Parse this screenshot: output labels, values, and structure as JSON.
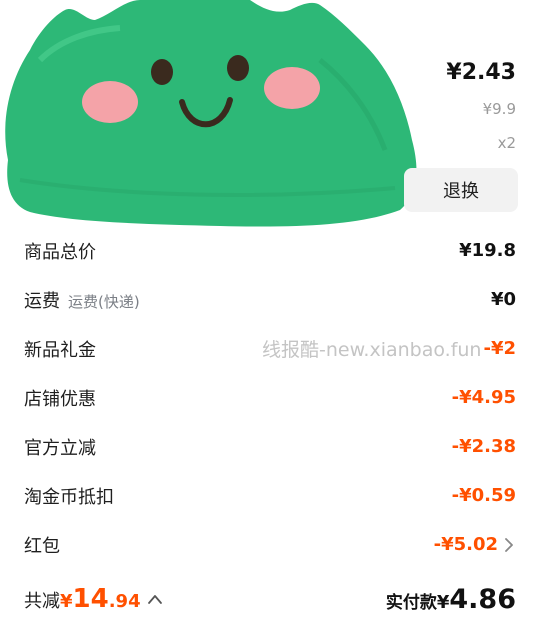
{
  "item": {
    "price": "¥2.43",
    "original_price": "¥9.9",
    "quantity": "x2",
    "return_label": "退换"
  },
  "rows": [
    {
      "label": "商品总价",
      "value": "¥19.8"
    },
    {
      "label": "运费",
      "sub": "运费(快递)",
      "value": "¥0"
    },
    {
      "label": "新品礼金",
      "watermark": "线报酷-new.xianbao.fun",
      "value": "-¥2"
    },
    {
      "label": "店铺优惠",
      "value": "-¥4.95"
    },
    {
      "label": "官方立减",
      "value": "-¥2.38"
    },
    {
      "label": "淘金币抵扣",
      "value": "-¥0.59"
    },
    {
      "label": "红包",
      "value": "-¥5.02"
    }
  ],
  "total": {
    "saved_label": "共减",
    "saved_currency": "¥",
    "saved_int": "14",
    "saved_dec": ".94",
    "paid_label": "实付款",
    "paid_currency": "¥",
    "paid_int": "4",
    "paid_dec": ".86"
  },
  "colors": {
    "discount": "#ff5000",
    "sticker_green": "#2db877",
    "sticker_cheek": "#f4a3a8"
  },
  "icons": {
    "red_packet_arrow": "chevron-right-icon",
    "total_toggle": "chevron-up-icon"
  }
}
